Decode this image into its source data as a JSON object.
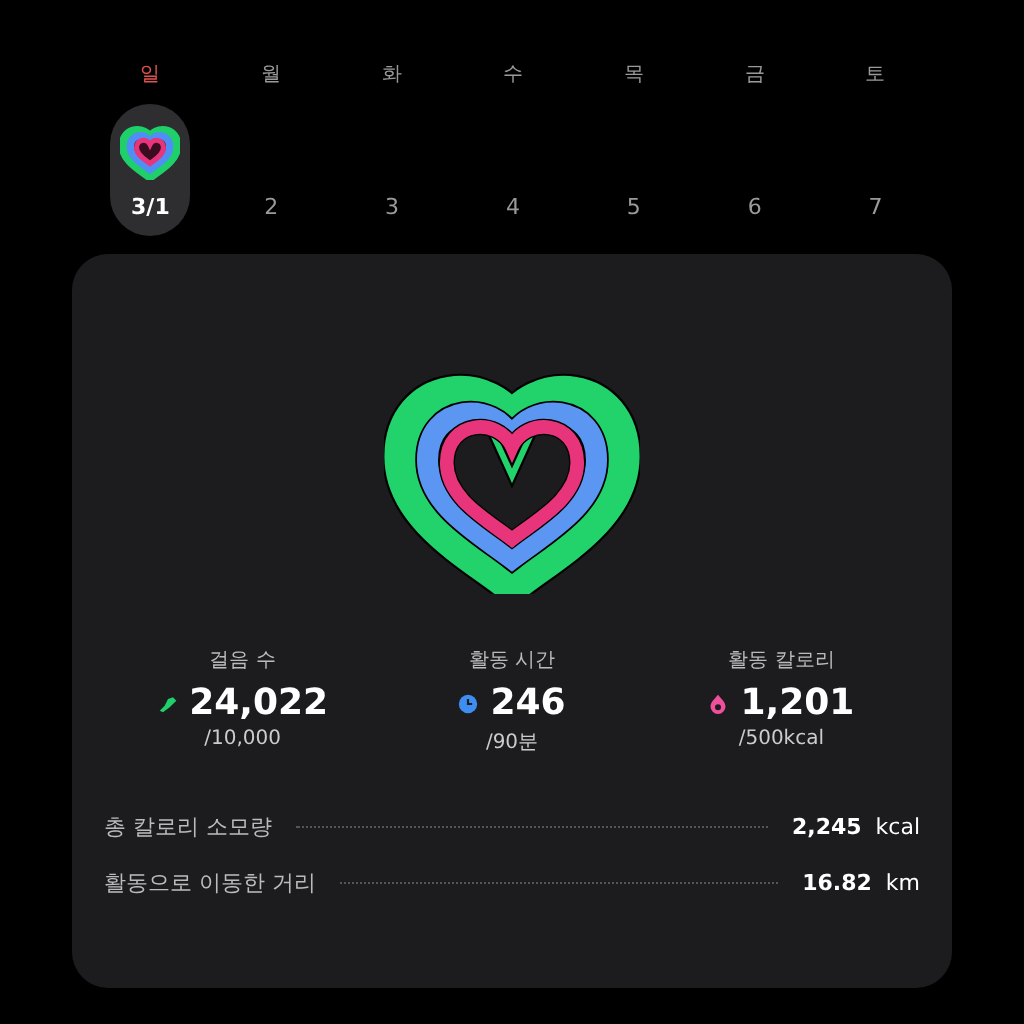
{
  "week": {
    "days": [
      {
        "weekday": "일",
        "date": "3/1",
        "selected": true,
        "sunday": true
      },
      {
        "weekday": "월",
        "date": "2",
        "selected": false,
        "sunday": false
      },
      {
        "weekday": "화",
        "date": "3",
        "selected": false,
        "sunday": false
      },
      {
        "weekday": "수",
        "date": "4",
        "selected": false,
        "sunday": false
      },
      {
        "weekday": "목",
        "date": "5",
        "selected": false,
        "sunday": false
      },
      {
        "weekday": "금",
        "date": "6",
        "selected": false,
        "sunday": false
      },
      {
        "weekday": "토",
        "date": "7",
        "selected": false,
        "sunday": false
      }
    ]
  },
  "stats": [
    {
      "kind": "steps",
      "label": "걸음 수",
      "value": "24,022",
      "goal": "/10,000",
      "color": "#1fcf6a"
    },
    {
      "kind": "time",
      "label": "활동 시간",
      "value": "246",
      "goal": "/90분",
      "color": "#3d8ef0"
    },
    {
      "kind": "calories",
      "label": "활동 칼로리",
      "value": "1,201",
      "goal": "/500kcal",
      "color": "#f0509a"
    }
  ],
  "details": [
    {
      "label": "총 칼로리 소모량",
      "value": "2,245",
      "unit": "kcal"
    },
    {
      "label": "활동으로 이동한 거리",
      "value": "16.82",
      "unit": "km"
    }
  ]
}
